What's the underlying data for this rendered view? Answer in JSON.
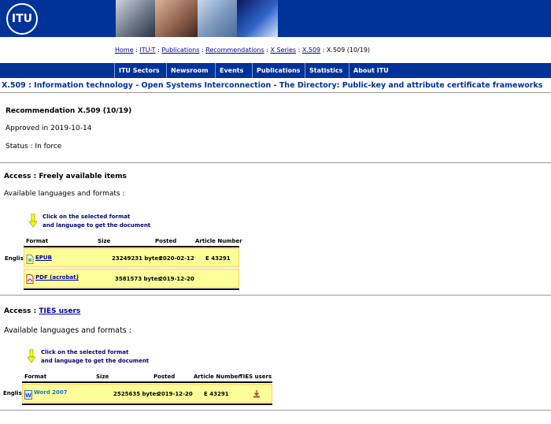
{
  "header": {
    "logo_text": "ITU",
    "breadcrumb": [
      {
        "label": "Home",
        "link": true
      },
      {
        "label": "ITU-T",
        "link": true
      },
      {
        "label": "Publications",
        "link": true
      },
      {
        "label": "Recommendations",
        "link": true
      },
      {
        "label": "X Series",
        "link": true
      },
      {
        "label": "X.509",
        "link": true
      },
      {
        "label": "X.509 (10/19)",
        "link": false
      }
    ],
    "separator": " : "
  },
  "nav": [
    "ITU Sectors",
    "Newsroom",
    "Events",
    "Publications",
    "Statistics",
    "About ITU"
  ],
  "page_title": "X.509 : Information technology - Open Systems Interconnection - The Directory: Public-key and attribute certificate frameworks",
  "rec": {
    "heading": "Recommendation X.509 (10/19)",
    "approved": "Approved in 2019-10-14",
    "status": "Status : In force"
  },
  "free_section": {
    "access_prefix": "Access : ",
    "access_label": "Freely available items",
    "avail": "Available languages and formats :",
    "hint1": "Click on the selected format",
    "hint2": "and language to get the document",
    "headers": {
      "format": "Format",
      "size": "Size",
      "posted": "Posted",
      "article": "Article Number"
    },
    "language": "English",
    "rows": [
      {
        "format": "EPUB",
        "size": "23249231 bytes",
        "posted": "2020-02-12",
        "article": "E 43291"
      },
      {
        "format": "PDF (acrobat)",
        "size": "3581573 bytes",
        "posted": "2019-12-20",
        "article": ""
      }
    ]
  },
  "ties_section": {
    "access_prefix": "Access : ",
    "access_label": "TIES users",
    "avail": "Available languages and formats :",
    "hint1": "Click on the selected format",
    "hint2": "and language to get the document",
    "headers": {
      "format": "Format",
      "size": "Size",
      "posted": "Posted",
      "article": "Article Number",
      "ties": "TIES users"
    },
    "language": "English",
    "rows": [
      {
        "format": "Word 2007",
        "size": "2525635 bytes",
        "posted": "2019-12-20",
        "article": "E 43291",
        "ties_icon": "download-icon"
      }
    ]
  },
  "colors": {
    "brand_blue": "#003399",
    "row_yellow": "#ffff99",
    "link": "#00009c"
  }
}
